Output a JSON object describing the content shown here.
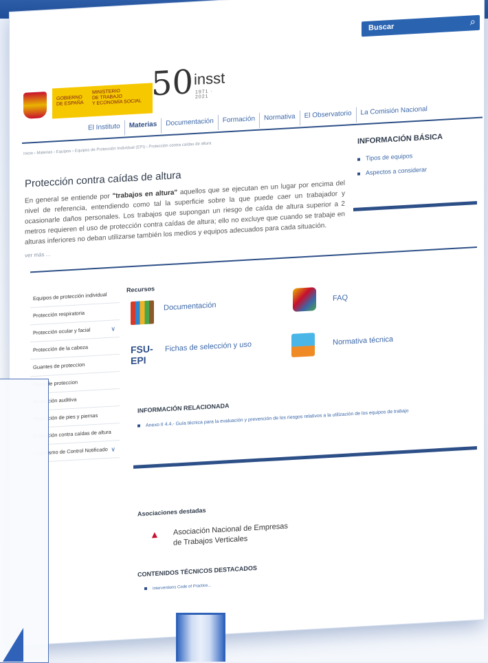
{
  "header": {
    "search_label": "Buscar",
    "search_icon": "magnifier",
    "user_icon": "person"
  },
  "logos": {
    "gov_left": "GOBIERNO\nDE ESPAÑA",
    "gov_right": "MINISTERIO\nDE TRABAJO\nY ECONOMÍA SOCIAL",
    "insst_number": "50",
    "insst_word": "insst",
    "insst_years": "1971 · 2021"
  },
  "nav": {
    "items": [
      "El Instituto",
      "Materias",
      "Documentación",
      "Formación",
      "Normativa",
      "El Observatorio",
      "La Comisión Nacional"
    ],
    "active": "Materias"
  },
  "breadcrumb": "Inicio  ›  Materias  ›  Equipos  ›  Equipos de Protección Individual (EPI)  ›  Protección contra caídas de altura",
  "page": {
    "title": "Protección contra caídas de altura",
    "intro_before": "En general se entiende por ",
    "intro_bold": "\"trabajos en altura\"",
    "intro_after": " aquellos que se ejecutan en un lugar por encima del nivel de referencia, entendiendo como tal la superficie sobre la que puede caer un trabajador y ocasionarle daños personales. Los trabajos que supongan un riesgo de caída de altura superior a 2 metros requieren el uso de protección contra caídas de altura; ello no excluye que cuando se trabaje en alturas inferiores no deban utilizarse también los medios y equipos adecuados para cada situación.",
    "read_more": "ver más ..."
  },
  "info_basica": {
    "title": "INFORMACIÓN BÁSICA",
    "items": [
      "Tipos de equipos",
      "Aspectos a considerar"
    ]
  },
  "sidebar": {
    "items": [
      "Equipos de protección individual",
      "Protección respiratoria",
      "Protección ocular y facial",
      "Protección de la cabeza",
      "Guantes de proteccion",
      "Ropa de proteccion",
      "Protección auditiva",
      "Protección de pies y piernas",
      "Protección contra caídas de altura",
      "Organismo de Control Notificado"
    ]
  },
  "recursos": {
    "title": "Recursos",
    "documentacion": "Documentación",
    "faq": "FAQ",
    "fichas": "Fichas de selección y uso",
    "fsu_badge": "FSU-\nEPI",
    "normativa": "Normativa técnica"
  },
  "relacionada": {
    "title": "INFORMACIÓN RELACIONADA",
    "item": "Anexo II 4.4.- Guía técnica para la evaluación y prevención de los riesgos relativos a la utilización de los equipos de trabajo"
  },
  "asociaciones": {
    "title": "Asociaciones destadas",
    "name": "Asociación Nacional de Empresas de Trabajos Verticales"
  },
  "contenidos": {
    "title": "CONTENIDOS TÉCNICOS DESTACADOS",
    "item": "Interventions Code of Practice..."
  }
}
